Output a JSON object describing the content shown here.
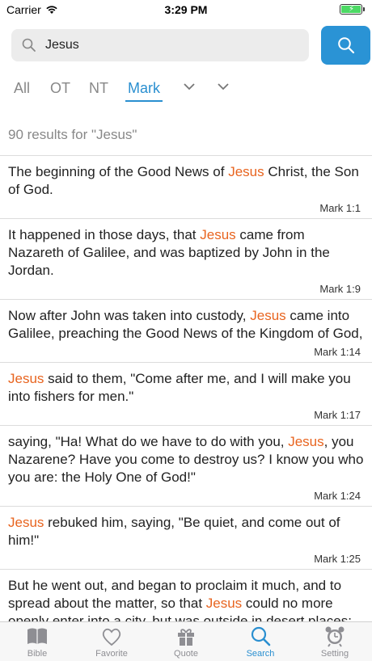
{
  "status": {
    "carrier": "Carrier",
    "time": "3:29 PM"
  },
  "search": {
    "query": "Jesus"
  },
  "tabs": [
    "All",
    "OT",
    "NT",
    "Mark"
  ],
  "active_tab": "Mark",
  "results_count": "90 results for \"Jesus\"",
  "highlight_term": "Jesus",
  "results": [
    {
      "parts": [
        "The beginning of the Good News of ",
        "Jesus",
        " Christ, the Son of God."
      ],
      "ref": "Mark 1:1"
    },
    {
      "parts": [
        "It happened in those days, that ",
        "Jesus",
        " came from Nazareth of Galilee, and was baptized by John in the Jordan."
      ],
      "ref": "Mark 1:9"
    },
    {
      "parts": [
        "Now after John was taken into custody, ",
        "Jesus",
        " came into Galilee, preaching the Good News of the Kingdom of God,"
      ],
      "ref": "Mark 1:14"
    },
    {
      "parts": [
        "",
        "Jesus",
        " said to them, \"Come after me, and I will make you into fishers for men.\""
      ],
      "ref": "Mark 1:17"
    },
    {
      "parts": [
        "saying, \"Ha! What do we have to do with you, ",
        "Jesus",
        ", you Nazarene? Have you come to destroy us? I know you who you are: the Holy One of God!\""
      ],
      "ref": "Mark 1:24"
    },
    {
      "parts": [
        "",
        "Jesus",
        " rebuked him, saying, \"Be quiet, and come out of him!\""
      ],
      "ref": "Mark 1:25"
    },
    {
      "parts": [
        "But he went out, and began to proclaim it much, and to spread about the matter, so that ",
        "Jesus",
        " could no more openly enter into a city, but was outside in desert places: and they came to him from everywhere."
      ],
      "ref": ""
    }
  ],
  "tabbar": [
    {
      "label": "Bible",
      "icon": "book-icon"
    },
    {
      "label": "Favorite",
      "icon": "heart-icon"
    },
    {
      "label": "Quote",
      "icon": "gift-icon"
    },
    {
      "label": "Search",
      "icon": "search-icon"
    },
    {
      "label": "Setting",
      "icon": "alarm-clock-icon"
    }
  ],
  "active_tabbar": "Search",
  "colors": {
    "accent": "#2a8fd0",
    "highlight": "#e8641f",
    "search_button": "#2a93d5"
  }
}
